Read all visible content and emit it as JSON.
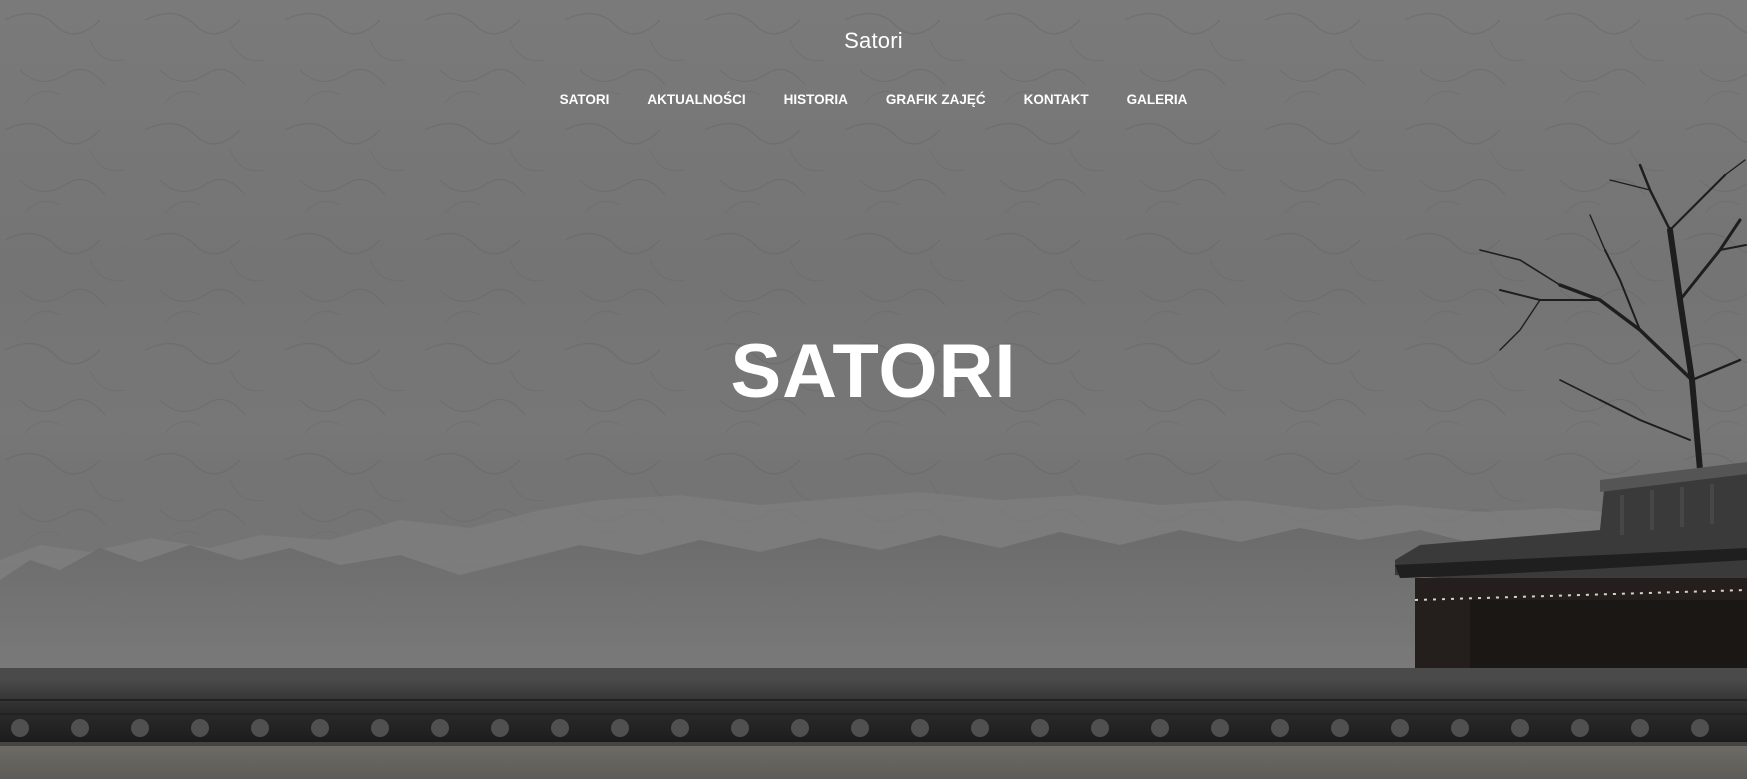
{
  "site": {
    "title": "Satori"
  },
  "nav": {
    "items": [
      {
        "label": "SATORI"
      },
      {
        "label": "AKTUALNOŚCI"
      },
      {
        "label": "HISTORIA"
      },
      {
        "label": "GRAFIK ZAJĘĆ"
      },
      {
        "label": "KONTAKT"
      },
      {
        "label": "GALERIA"
      }
    ]
  },
  "hero": {
    "heading": "SATORI"
  },
  "colors": {
    "text": "#ffffff",
    "overlay": "#737373",
    "roof": "#2a2a2a"
  }
}
